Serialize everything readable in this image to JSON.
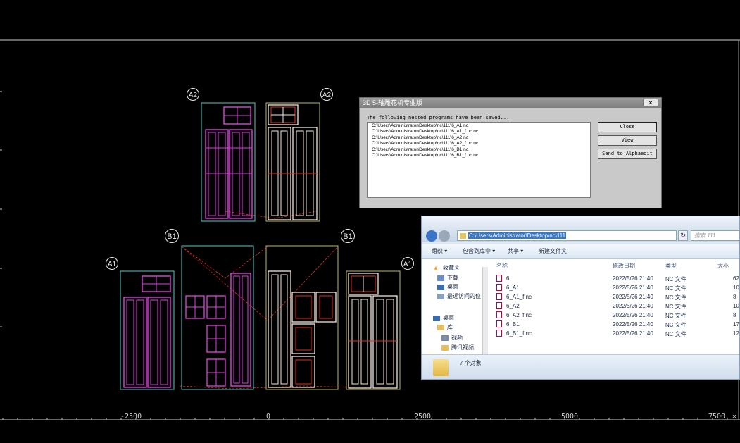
{
  "cad": {
    "part_labels": [
      "A2",
      "A2",
      "B1",
      "B1",
      "A1",
      "A1"
    ],
    "ruler_labels": [
      "-2500",
      "0",
      "2500",
      "5000",
      "7500"
    ],
    "ruler_end_glyph": "✕",
    "colors": {
      "magenta": "#e040e0",
      "white_outline": "#f4e6dc",
      "red_toolpath": "#e03020",
      "cyan_outline": "#59c6c6",
      "yellow_outline": "#b8b86a"
    }
  },
  "dialog": {
    "title": "3D 5-轴雕花机专业版",
    "close_x": "✕",
    "message": "The following nested programs have been saved...",
    "files": [
      "C:\\Users\\Administrator\\Desktop\\nc\\111\\6_A1.nc",
      "C:\\Users\\Administrator\\Desktop\\nc\\111\\6_A1_f.nc.nc",
      "C:\\Users\\Administrator\\Desktop\\nc\\111\\6_A2.nc",
      "C:\\Users\\Administrator\\Desktop\\nc\\111\\6_A2_f.nc.nc",
      "C:\\Users\\Administrator\\Desktop\\nc\\111\\6_B1.nc",
      "C:\\Users\\Administrator\\Desktop\\nc\\111\\6_B1_f.nc.nc"
    ],
    "buttons": {
      "close": "Close",
      "view": "View",
      "send": "Send to Alphaedit"
    }
  },
  "explorer": {
    "path": "C:\\Users\\Administrator\\Desktop\\nc\\111",
    "search_placeholder": "搜索 111",
    "refresh_glyph": "↻",
    "toolbar": {
      "organize": "组织 ▾",
      "library": "包含到库中 ▾",
      "share": "共享 ▾",
      "new_folder": "新建文件夹"
    },
    "sidebar": [
      "收藏夹",
      "下载",
      "桌面",
      "最近访问的位",
      "桌面",
      "库",
      "视频",
      "腾讯视频"
    ],
    "columns": {
      "name": "名称",
      "date": "修改日期",
      "type": "类型",
      "size": "大小"
    },
    "files": [
      {
        "name": "6",
        "date": "2022/5/26 21:40",
        "type": "NC 文件",
        "size": "62"
      },
      {
        "name": "6_A1",
        "date": "2022/5/26 21:40",
        "type": "NC 文件",
        "size": "10"
      },
      {
        "name": "6_A1_f.nc",
        "date": "2022/5/26 21:40",
        "type": "NC 文件",
        "size": "8"
      },
      {
        "name": "6_A2",
        "date": "2022/5/26 21:40",
        "type": "NC 文件",
        "size": "10"
      },
      {
        "name": "6_A2_f.nc",
        "date": "2022/5/26 21:40",
        "type": "NC 文件",
        "size": "8"
      },
      {
        "name": "6_B1",
        "date": "2022/5/26 21:40",
        "type": "NC 文件",
        "size": "17"
      },
      {
        "name": "6_B1_f.nc",
        "date": "2022/5/26 21:40",
        "type": "NC 文件",
        "size": "12"
      }
    ],
    "status": "7 个对象"
  }
}
